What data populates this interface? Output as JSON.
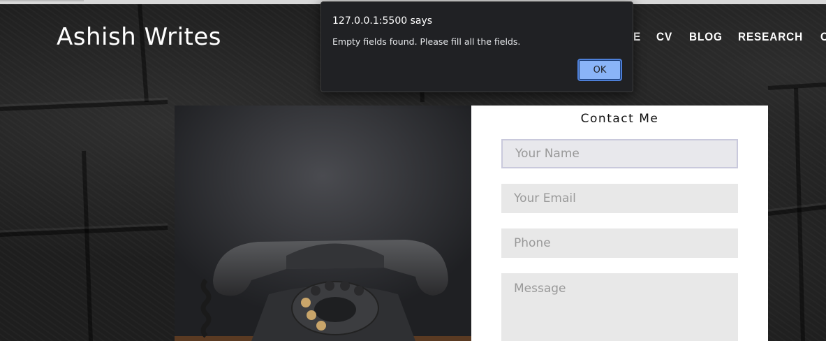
{
  "site": {
    "title": "Ashish Writes"
  },
  "nav": {
    "items": [
      {
        "label": "E"
      },
      {
        "label": "CV"
      },
      {
        "label": "BLOG"
      },
      {
        "label": "RESEARCH"
      },
      {
        "label": "C"
      }
    ]
  },
  "contact": {
    "title": "Contact Me",
    "fields": {
      "name_placeholder": "Your Name",
      "email_placeholder": "Your Email",
      "phone_placeholder": "Phone",
      "message_placeholder": "Message"
    }
  },
  "dialog": {
    "origin": "127.0.0.1:5500 says",
    "message": "Empty fields found. Please fill all the fields.",
    "ok_label": "OK"
  },
  "colors": {
    "dialog_bg": "#202124",
    "ok_button": "#8ab4f8",
    "field_bg": "#e8e8e8"
  },
  "icons": {
    "hero": "rotary-telephone-icon"
  }
}
